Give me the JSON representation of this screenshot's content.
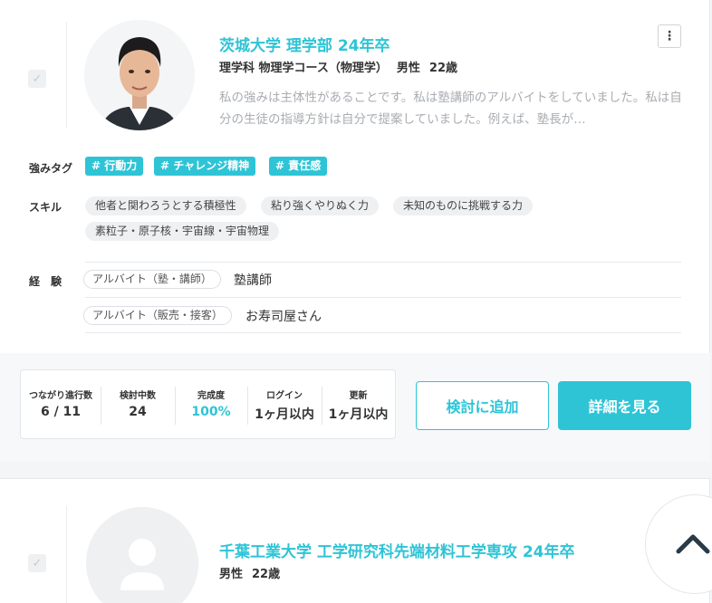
{
  "candidates": [
    {
      "school": "茨城大学 理学部 24年卒",
      "department": "理学科 物理学コース（物理学）",
      "gender": "男性",
      "age": "22歳",
      "intro": "私の強みは主体性があることです。私は塾講師のアルバイトをしていました。私は自分の生徒の指導方針は自分で提案していました。例えば、塾長が…",
      "menu_icon": "⋮",
      "strength_label": "強みタグ",
      "strength_tags": [
        "# 行動力",
        "# チャレンジ精神",
        "# 責任感"
      ],
      "skills_label": "スキル",
      "skills": [
        "他者と関わろうとする積極性",
        "粘り強くやりぬく力",
        "未知のものに挑戦する力",
        "素粒子・原子核・宇宙線・宇宙物理"
      ],
      "experience_label": "経　験",
      "experiences": [
        {
          "category": "アルバイト（塾・講師）",
          "detail": "塾講師"
        },
        {
          "category": "アルバイト（販売・接客）",
          "detail": "お寿司屋さん"
        }
      ],
      "stats": [
        {
          "label": "つながり進行数",
          "value": "6 / 11"
        },
        {
          "label": "検討中数",
          "value": "24"
        },
        {
          "label": "完成度",
          "value": "100%"
        },
        {
          "label": "ログイン",
          "value": "1ヶ月以内"
        },
        {
          "label": "更新",
          "value": "1ヶ月以内"
        }
      ],
      "add_button": "検討に追加",
      "detail_button": "詳細を見る"
    },
    {
      "school": "千葉工業大学 工学研究科先端材料工学専攻 24年卒",
      "gender": "男性",
      "age": "22歳"
    }
  ],
  "colors": {
    "accent": "#2ec4d6"
  },
  "checkbox_icon": "✓",
  "scroll_top_icon": "chevron-up-icon"
}
